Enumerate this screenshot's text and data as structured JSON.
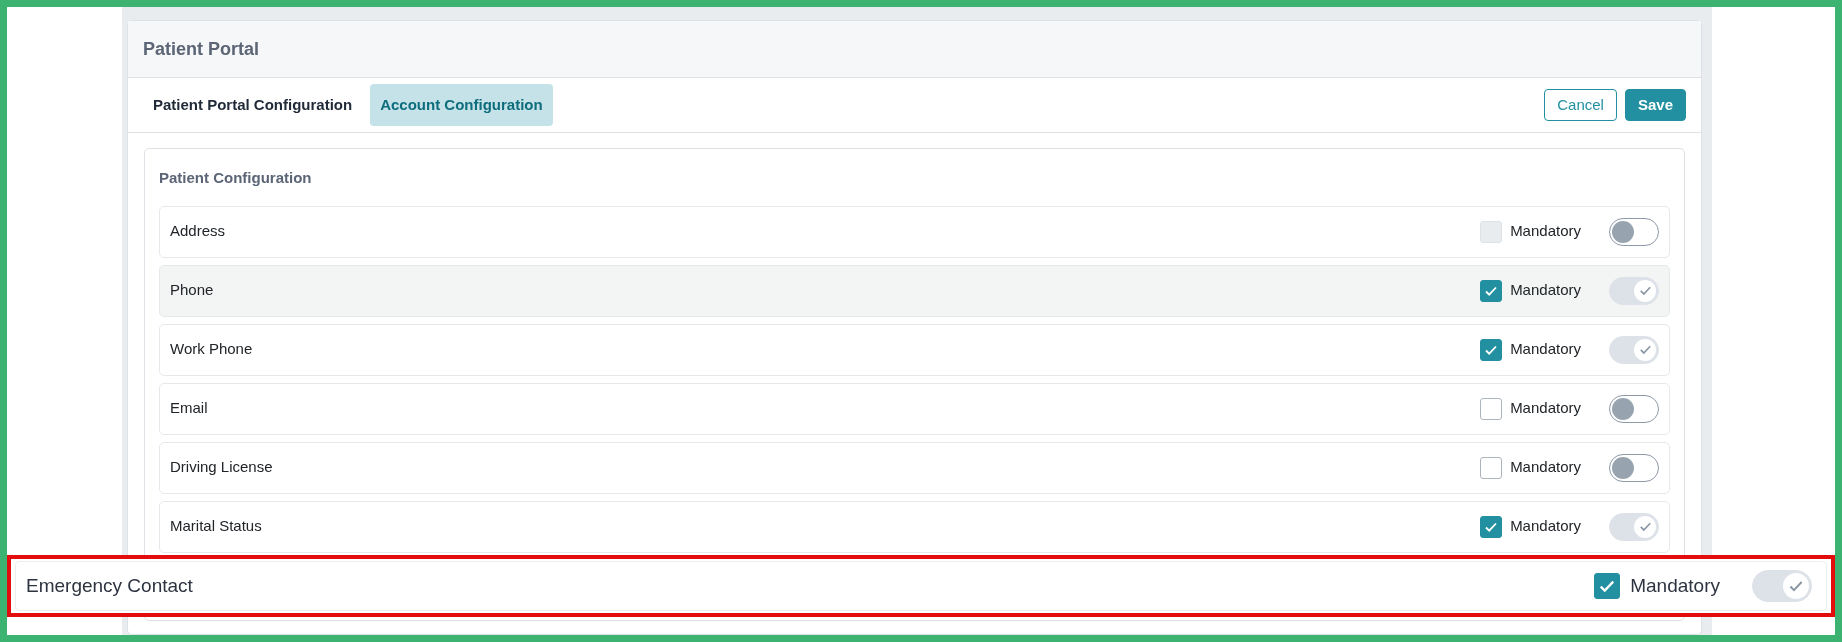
{
  "panel": {
    "title": "Patient Portal"
  },
  "tabs": [
    {
      "label": "Patient Portal Configuration",
      "selected": false
    },
    {
      "label": "Account Configuration",
      "selected": true
    }
  ],
  "actions": [
    {
      "label": "Cancel",
      "kind": "outline"
    },
    {
      "label": "Save",
      "kind": "primary"
    }
  ],
  "section": {
    "title": "Patient Configuration"
  },
  "fields": [
    {
      "label": "Address",
      "mandatory_label": "Mandatory",
      "mandatory": false,
      "mandatory_disabled": true,
      "on": false,
      "highlighted": false
    },
    {
      "label": "Phone",
      "mandatory_label": "Mandatory",
      "mandatory": true,
      "mandatory_disabled": false,
      "on": true,
      "highlighted": true
    },
    {
      "label": "Work Phone",
      "mandatory_label": "Mandatory",
      "mandatory": true,
      "mandatory_disabled": false,
      "on": true,
      "highlighted": false
    },
    {
      "label": "Email",
      "mandatory_label": "Mandatory",
      "mandatory": false,
      "mandatory_disabled": false,
      "on": false,
      "highlighted": false
    },
    {
      "label": "Driving License",
      "mandatory_label": "Mandatory",
      "mandatory": false,
      "mandatory_disabled": false,
      "on": false,
      "highlighted": false
    },
    {
      "label": "Marital Status",
      "mandatory_label": "Mandatory",
      "mandatory": true,
      "mandatory_disabled": false,
      "on": true,
      "highlighted": false
    }
  ],
  "callout": {
    "label": "Emergency Contact",
    "mandatory_label": "Mandatory",
    "mandatory": true,
    "on": true
  }
}
